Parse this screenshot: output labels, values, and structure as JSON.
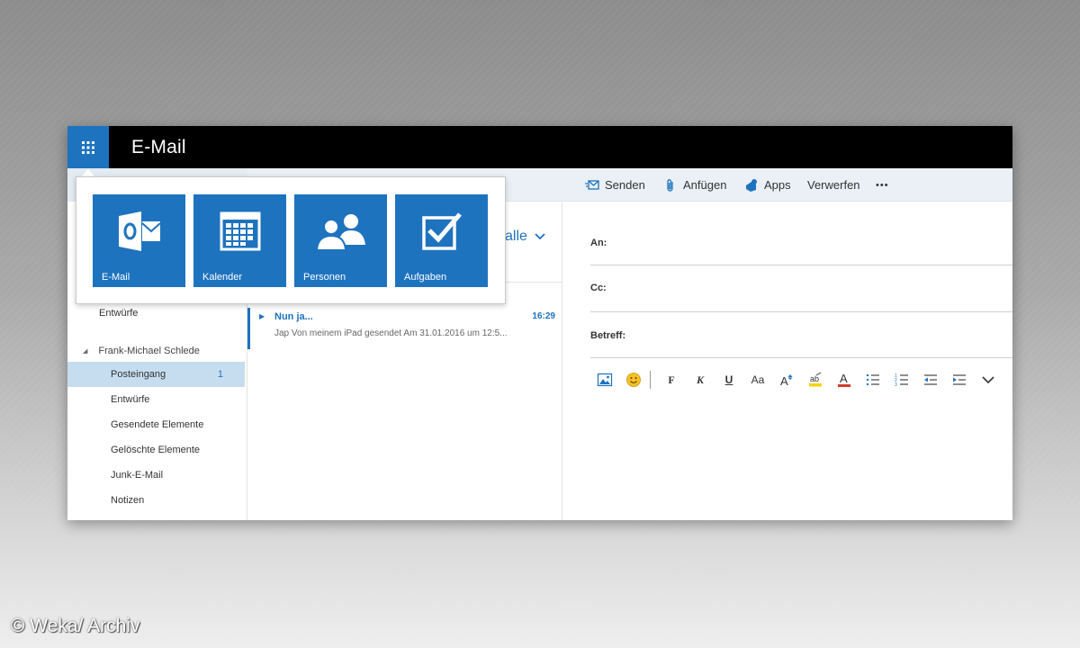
{
  "app": {
    "title": "E-Mail"
  },
  "commands": {
    "send": "Senden",
    "attach": "Anfügen",
    "apps": "Apps",
    "discard": "Verwerfen",
    "more": "•••"
  },
  "launcher": {
    "tiles": [
      {
        "label": "E-Mail",
        "icon": "outlook-icon"
      },
      {
        "label": "Kalender",
        "icon": "calendar-icon"
      },
      {
        "label": "Personen",
        "icon": "people-icon"
      },
      {
        "label": "Aufgaben",
        "icon": "tasks-icon"
      }
    ]
  },
  "sidebar": {
    "top_folder": "Entwürfe",
    "account": "Frank-Michael Schlede",
    "folders": [
      {
        "label": "Posteingang",
        "count": "1",
        "selected": true
      },
      {
        "label": "Entwürfe"
      },
      {
        "label": "Gesendete Elemente"
      },
      {
        "label": "Gelöschte Elemente"
      },
      {
        "label": "Junk-E-Mail"
      },
      {
        "label": "Notizen"
      }
    ]
  },
  "messagelist": {
    "filter_label": "alle",
    "messages": [
      {
        "sender": "Nun ja...",
        "time": "16:29",
        "preview": "Jap  Von meinem iPad gesendet  Am 31.01.2016 um 12:5..."
      }
    ]
  },
  "compose": {
    "to_label": "An:",
    "cc_label": "Cc:",
    "subject_label": "Betreff:"
  },
  "format_toolbar": {
    "bold": "F",
    "italic": "K",
    "underline": "U",
    "font_size": "Aa"
  },
  "colors": {
    "accent": "#1e73be",
    "topbar": "#000000",
    "selected_folder": "#c6ddf0"
  },
  "watermark": "© Weka/ Archiv"
}
